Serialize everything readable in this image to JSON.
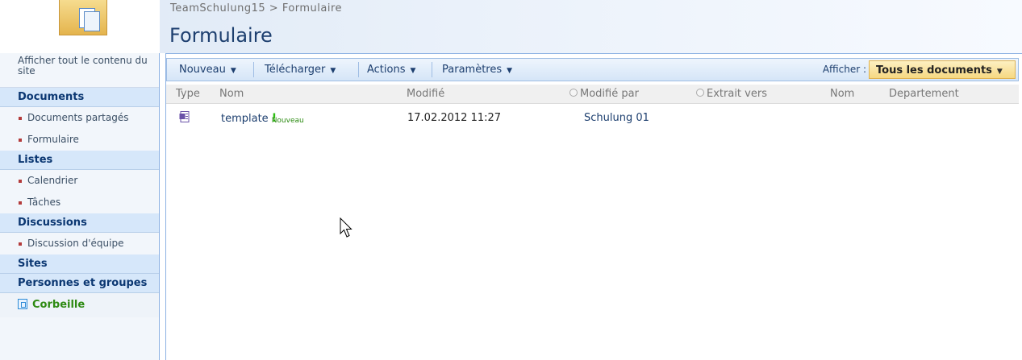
{
  "header": {
    "breadcrumb_site": "TeamSchulung15",
    "breadcrumb_sep": ">",
    "breadcrumb_page": "Formulaire",
    "title": "Formulaire"
  },
  "sidebar": {
    "view_all": "Afficher tout le contenu du site",
    "sections": [
      {
        "heading": "Documents",
        "items": [
          "Documents partagés",
          "Formulaire"
        ]
      },
      {
        "heading": "Listes",
        "items": [
          "Calendrier",
          "Tâches"
        ]
      },
      {
        "heading": "Discussions",
        "items": [
          "Discussion d'équipe"
        ]
      },
      {
        "heading": "Sites",
        "items": []
      },
      {
        "heading": "Personnes et groupes",
        "items": []
      }
    ],
    "recycle_bin": "Corbeille"
  },
  "toolbar": {
    "new": "Nouveau",
    "upload": "Télécharger",
    "actions": "Actions",
    "settings": "Paramètres",
    "view_label": "Afficher :",
    "view_value": "Tous les documents"
  },
  "table": {
    "headers": [
      "Type",
      "Nom",
      "Modifié",
      "Modifié par",
      "Extrait vers",
      "Nom",
      "Departement"
    ],
    "rows": [
      {
        "name": "template",
        "new_badge": "Nouveau",
        "new_mark": "!",
        "modified": "17.02.2012 11:27",
        "modified_by": "Schulung 01"
      }
    ]
  },
  "colors": {
    "title": "#1d3f6f",
    "sidebar_heading": "#0b3772",
    "recycle": "#2d8a12",
    "view_select": "#f6d881"
  },
  "icons": [
    "folder-logo-icon",
    "recycle-bin-icon",
    "word-document-icon",
    "mouse-pointer-icon"
  ]
}
